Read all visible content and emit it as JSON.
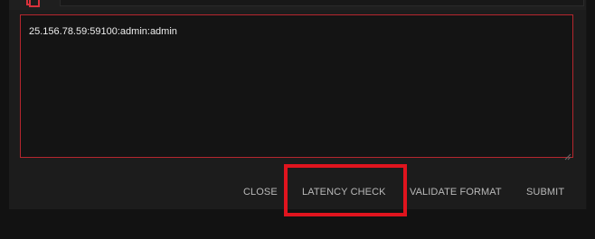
{
  "dialog": {
    "proxy_list_text": "25.156.78.59:59100:admin:admin",
    "actions": {
      "close_label": "CLOSE",
      "latency_check_label": "LATENCY CHECK",
      "validate_format_label": "VALIDATE FORMAT",
      "submit_label": "SUBMIT"
    }
  },
  "colors": {
    "accent_red": "#b6262e",
    "highlight_red": "#e0141e",
    "panel_bg": "#1c1c1c",
    "text_light": "#ededed",
    "action_text": "#b9b9b9"
  },
  "icons": {
    "header_icon": "document-icon",
    "grip_icon": "resize-grip-icon"
  }
}
